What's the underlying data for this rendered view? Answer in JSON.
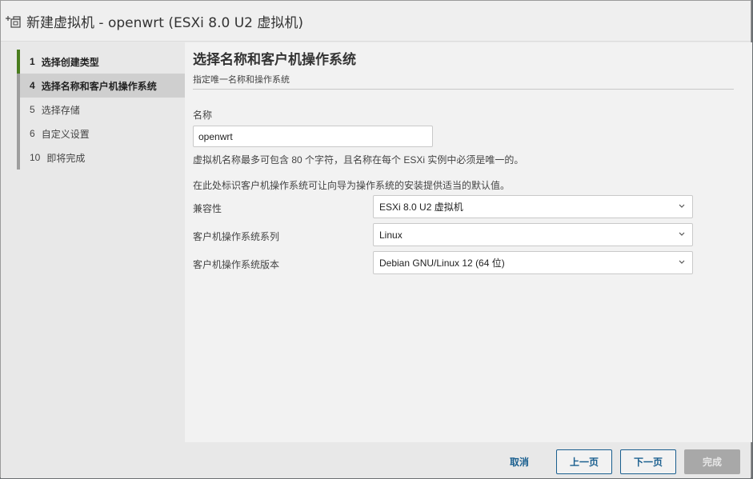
{
  "window": {
    "title": "新建虚拟机 - openwrt (ESXi 8.0 U2 虚拟机)",
    "icon": "new-vm-icon"
  },
  "steps": [
    {
      "num": "1",
      "label": "选择创建类型",
      "state": "completed"
    },
    {
      "num": "4",
      "label": "选择名称和客户机操作系统",
      "state": "active"
    },
    {
      "num": "5",
      "label": "选择存储",
      "state": "pending"
    },
    {
      "num": "6",
      "label": "自定义设置",
      "state": "pending"
    },
    {
      "num": "10",
      "label": "即将完成",
      "state": "pending"
    }
  ],
  "page": {
    "title": "选择名称和客户机操作系统",
    "subtitle": "指定唯一名称和操作系统"
  },
  "form": {
    "name_label": "名称",
    "name_value": "openwrt",
    "name_hint": "虚拟机名称最多可包含 80 个字符，且名称在每个 ESXi 实例中必须是唯一的。",
    "os_hint": "在此处标识客户机操作系统可让向导为操作系统的安装提供适当的默认值。",
    "compat_label": "兼容性",
    "compat_value": "ESXi 8.0 U2 虚拟机",
    "family_label": "客户机操作系统系列",
    "family_value": "Linux",
    "version_label": "客户机操作系统版本",
    "version_value": "Debian GNU/Linux 12 (64 位)"
  },
  "footer": {
    "cancel": "取消",
    "back": "上一页",
    "next": "下一页",
    "finish": "完成"
  },
  "colors": {
    "accent": "#1a5f8f",
    "step_done": "#4a7d1e",
    "disabled": "#a8a8a8"
  }
}
